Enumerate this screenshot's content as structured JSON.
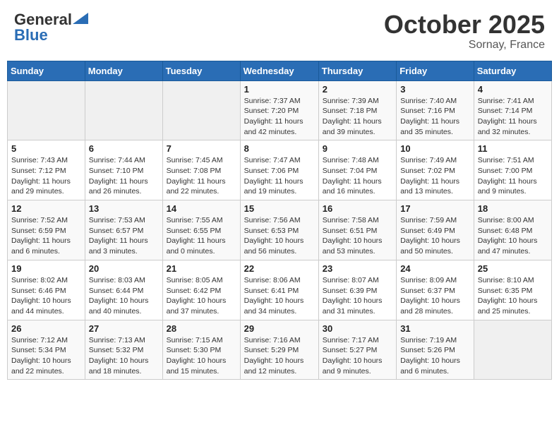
{
  "header": {
    "logo_general": "General",
    "logo_blue": "Blue",
    "month_title": "October 2025",
    "location": "Sornay, France"
  },
  "weekdays": [
    "Sunday",
    "Monday",
    "Tuesday",
    "Wednesday",
    "Thursday",
    "Friday",
    "Saturday"
  ],
  "weeks": [
    [
      {
        "day": "",
        "empty": true
      },
      {
        "day": "",
        "empty": true
      },
      {
        "day": "",
        "empty": true
      },
      {
        "day": "1",
        "sunrise": "Sunrise: 7:37 AM",
        "sunset": "Sunset: 7:20 PM",
        "daylight": "Daylight: 11 hours and 42 minutes."
      },
      {
        "day": "2",
        "sunrise": "Sunrise: 7:39 AM",
        "sunset": "Sunset: 7:18 PM",
        "daylight": "Daylight: 11 hours and 39 minutes."
      },
      {
        "day": "3",
        "sunrise": "Sunrise: 7:40 AM",
        "sunset": "Sunset: 7:16 PM",
        "daylight": "Daylight: 11 hours and 35 minutes."
      },
      {
        "day": "4",
        "sunrise": "Sunrise: 7:41 AM",
        "sunset": "Sunset: 7:14 PM",
        "daylight": "Daylight: 11 hours and 32 minutes."
      }
    ],
    [
      {
        "day": "5",
        "sunrise": "Sunrise: 7:43 AM",
        "sunset": "Sunset: 7:12 PM",
        "daylight": "Daylight: 11 hours and 29 minutes."
      },
      {
        "day": "6",
        "sunrise": "Sunrise: 7:44 AM",
        "sunset": "Sunset: 7:10 PM",
        "daylight": "Daylight: 11 hours and 26 minutes."
      },
      {
        "day": "7",
        "sunrise": "Sunrise: 7:45 AM",
        "sunset": "Sunset: 7:08 PM",
        "daylight": "Daylight: 11 hours and 22 minutes."
      },
      {
        "day": "8",
        "sunrise": "Sunrise: 7:47 AM",
        "sunset": "Sunset: 7:06 PM",
        "daylight": "Daylight: 11 hours and 19 minutes."
      },
      {
        "day": "9",
        "sunrise": "Sunrise: 7:48 AM",
        "sunset": "Sunset: 7:04 PM",
        "daylight": "Daylight: 11 hours and 16 minutes."
      },
      {
        "day": "10",
        "sunrise": "Sunrise: 7:49 AM",
        "sunset": "Sunset: 7:02 PM",
        "daylight": "Daylight: 11 hours and 13 minutes."
      },
      {
        "day": "11",
        "sunrise": "Sunrise: 7:51 AM",
        "sunset": "Sunset: 7:00 PM",
        "daylight": "Daylight: 11 hours and 9 minutes."
      }
    ],
    [
      {
        "day": "12",
        "sunrise": "Sunrise: 7:52 AM",
        "sunset": "Sunset: 6:59 PM",
        "daylight": "Daylight: 11 hours and 6 minutes."
      },
      {
        "day": "13",
        "sunrise": "Sunrise: 7:53 AM",
        "sunset": "Sunset: 6:57 PM",
        "daylight": "Daylight: 11 hours and 3 minutes."
      },
      {
        "day": "14",
        "sunrise": "Sunrise: 7:55 AM",
        "sunset": "Sunset: 6:55 PM",
        "daylight": "Daylight: 11 hours and 0 minutes."
      },
      {
        "day": "15",
        "sunrise": "Sunrise: 7:56 AM",
        "sunset": "Sunset: 6:53 PM",
        "daylight": "Daylight: 10 hours and 56 minutes."
      },
      {
        "day": "16",
        "sunrise": "Sunrise: 7:58 AM",
        "sunset": "Sunset: 6:51 PM",
        "daylight": "Daylight: 10 hours and 53 minutes."
      },
      {
        "day": "17",
        "sunrise": "Sunrise: 7:59 AM",
        "sunset": "Sunset: 6:49 PM",
        "daylight": "Daylight: 10 hours and 50 minutes."
      },
      {
        "day": "18",
        "sunrise": "Sunrise: 8:00 AM",
        "sunset": "Sunset: 6:48 PM",
        "daylight": "Daylight: 10 hours and 47 minutes."
      }
    ],
    [
      {
        "day": "19",
        "sunrise": "Sunrise: 8:02 AM",
        "sunset": "Sunset: 6:46 PM",
        "daylight": "Daylight: 10 hours and 44 minutes."
      },
      {
        "day": "20",
        "sunrise": "Sunrise: 8:03 AM",
        "sunset": "Sunset: 6:44 PM",
        "daylight": "Daylight: 10 hours and 40 minutes."
      },
      {
        "day": "21",
        "sunrise": "Sunrise: 8:05 AM",
        "sunset": "Sunset: 6:42 PM",
        "daylight": "Daylight: 10 hours and 37 minutes."
      },
      {
        "day": "22",
        "sunrise": "Sunrise: 8:06 AM",
        "sunset": "Sunset: 6:41 PM",
        "daylight": "Daylight: 10 hours and 34 minutes."
      },
      {
        "day": "23",
        "sunrise": "Sunrise: 8:07 AM",
        "sunset": "Sunset: 6:39 PM",
        "daylight": "Daylight: 10 hours and 31 minutes."
      },
      {
        "day": "24",
        "sunrise": "Sunrise: 8:09 AM",
        "sunset": "Sunset: 6:37 PM",
        "daylight": "Daylight: 10 hours and 28 minutes."
      },
      {
        "day": "25",
        "sunrise": "Sunrise: 8:10 AM",
        "sunset": "Sunset: 6:35 PM",
        "daylight": "Daylight: 10 hours and 25 minutes."
      }
    ],
    [
      {
        "day": "26",
        "sunrise": "Sunrise: 7:12 AM",
        "sunset": "Sunset: 5:34 PM",
        "daylight": "Daylight: 10 hours and 22 minutes."
      },
      {
        "day": "27",
        "sunrise": "Sunrise: 7:13 AM",
        "sunset": "Sunset: 5:32 PM",
        "daylight": "Daylight: 10 hours and 18 minutes."
      },
      {
        "day": "28",
        "sunrise": "Sunrise: 7:15 AM",
        "sunset": "Sunset: 5:30 PM",
        "daylight": "Daylight: 10 hours and 15 minutes."
      },
      {
        "day": "29",
        "sunrise": "Sunrise: 7:16 AM",
        "sunset": "Sunset: 5:29 PM",
        "daylight": "Daylight: 10 hours and 12 minutes."
      },
      {
        "day": "30",
        "sunrise": "Sunrise: 7:17 AM",
        "sunset": "Sunset: 5:27 PM",
        "daylight": "Daylight: 10 hours and 9 minutes."
      },
      {
        "day": "31",
        "sunrise": "Sunrise: 7:19 AM",
        "sunset": "Sunset: 5:26 PM",
        "daylight": "Daylight: 10 hours and 6 minutes."
      },
      {
        "day": "",
        "empty": true
      }
    ]
  ]
}
